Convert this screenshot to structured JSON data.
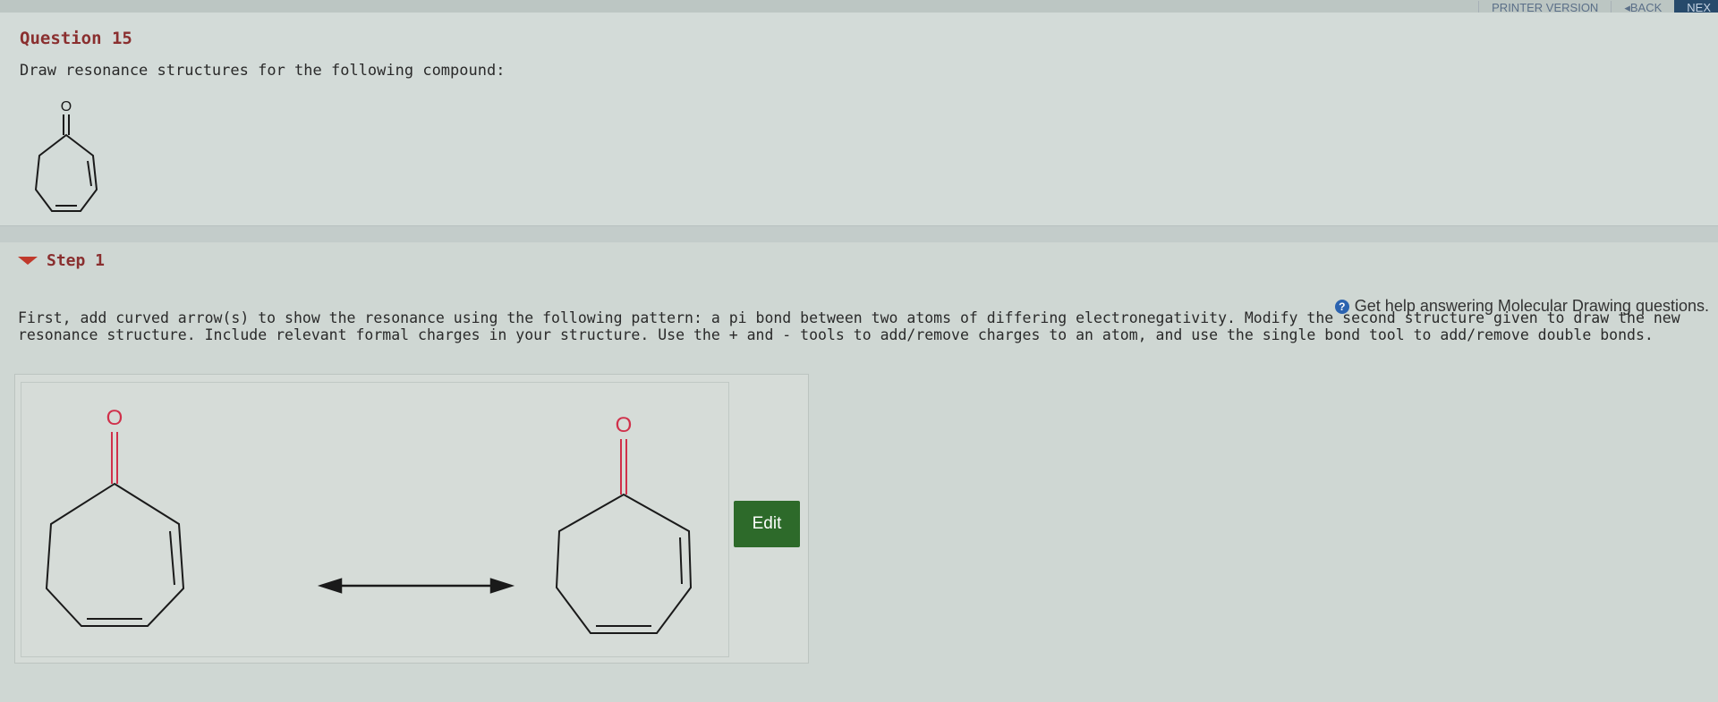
{
  "nav": {
    "printer_version": "PRINTER VERSION",
    "back": "◂BACK",
    "next": "NEX"
  },
  "question": {
    "title": "Question 15",
    "prompt": "Draw resonance structures for the following compound:",
    "oxygen_label": "O"
  },
  "step": {
    "label": "Step 1",
    "help_text": "Get help answering Molecular Drawing questions.",
    "instructions_line1": "First, add curved arrow(s) to show the resonance using the following pattern: a pi bond between two atoms of differing electronegativity. Modify the second structure given to draw the new",
    "instructions_line2": "resonance structure. Include relevant formal charges in your structure. Use the + and - tools to add/remove charges to an atom, and use the single bond tool to add/remove double bonds."
  },
  "workspace": {
    "structure_1_oxygen": "O",
    "structure_2_oxygen": "O",
    "edit_label": "Edit"
  },
  "colors": {
    "heading": "#8a2f2f",
    "oxygen": "#d0304a",
    "edit_button": "#2d6a2a"
  }
}
